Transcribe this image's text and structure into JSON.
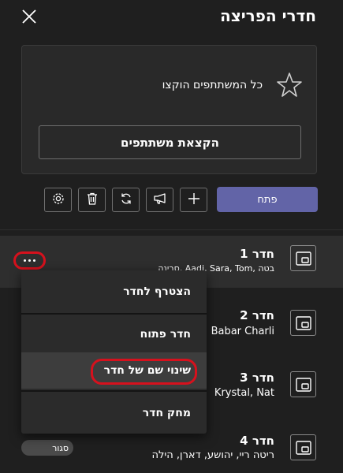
{
  "header": {
    "title": "חדרי הפריצה"
  },
  "assign_card": {
    "status_text": "כל המשתתפים הוקצו",
    "assign_button": "הקצאת משתתפים"
  },
  "toolbar": {
    "open_button": "פתח"
  },
  "rooms": [
    {
      "name": "חדר 1",
      "participants": "סרינה, Aadi, Sara, Tom, בטה"
    },
    {
      "name": "חדר 2",
      "participants": "Babar Charli"
    },
    {
      "name": "חדר 3",
      "participants": "Krystal, Nat"
    },
    {
      "name": "חדר 4",
      "participants": "ריטה ריי, יהושע, דארן, הילה",
      "status": "סגור"
    }
  ],
  "context_menu": {
    "items": [
      {
        "label": "הצטרף לחדר"
      },
      {
        "label": "חדר פתוח"
      },
      {
        "label": "שינוי שם של חדר"
      },
      {
        "label": "מחק חדר"
      }
    ]
  }
}
